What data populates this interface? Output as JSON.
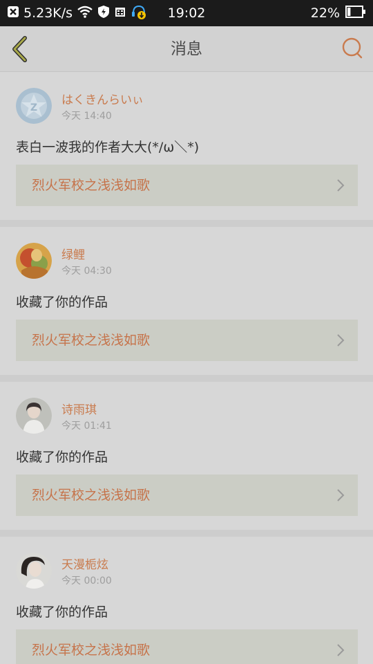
{
  "status_bar": {
    "network_speed": "5.23K/s",
    "time": "19:02",
    "battery": "22%",
    "battery_level": 0.22,
    "icons": [
      "close-notification-icon",
      "wifi-icon",
      "shield-icon",
      "calendar-icon",
      "headset-download-icon",
      "battery-icon"
    ]
  },
  "navbar": {
    "title": "消息",
    "back_icon": "back-chevron-icon",
    "search_icon": "search-icon"
  },
  "colors": {
    "accent": "#c97b4e",
    "work_title": "#c6734a",
    "overlay_bg": "#d6d6d6"
  },
  "messages": [
    {
      "username": "はくきんらいぃ",
      "time": "今天 14:40",
      "content": "表白一波我的作者大大(*/ω＼*)",
      "work_title": "烈火军校之浅浅如歌",
      "avatar": "default-avatar-icon"
    },
    {
      "username": "绿鲤",
      "time": "今天 04:30",
      "content": "收藏了你的作品",
      "work_title": "烈火军校之浅浅如歌",
      "avatar": "illustrated-avatar"
    },
    {
      "username": "诗雨琪",
      "time": "今天 01:41",
      "content": "收藏了你的作品",
      "work_title": "烈火军校之浅浅如歌",
      "avatar": "photo-avatar"
    },
    {
      "username": "天漫栀炫",
      "time": "今天 00:00",
      "content": "收藏了你的作品",
      "work_title": "烈火军校之浅浅如歌",
      "avatar": "photo-avatar"
    }
  ]
}
